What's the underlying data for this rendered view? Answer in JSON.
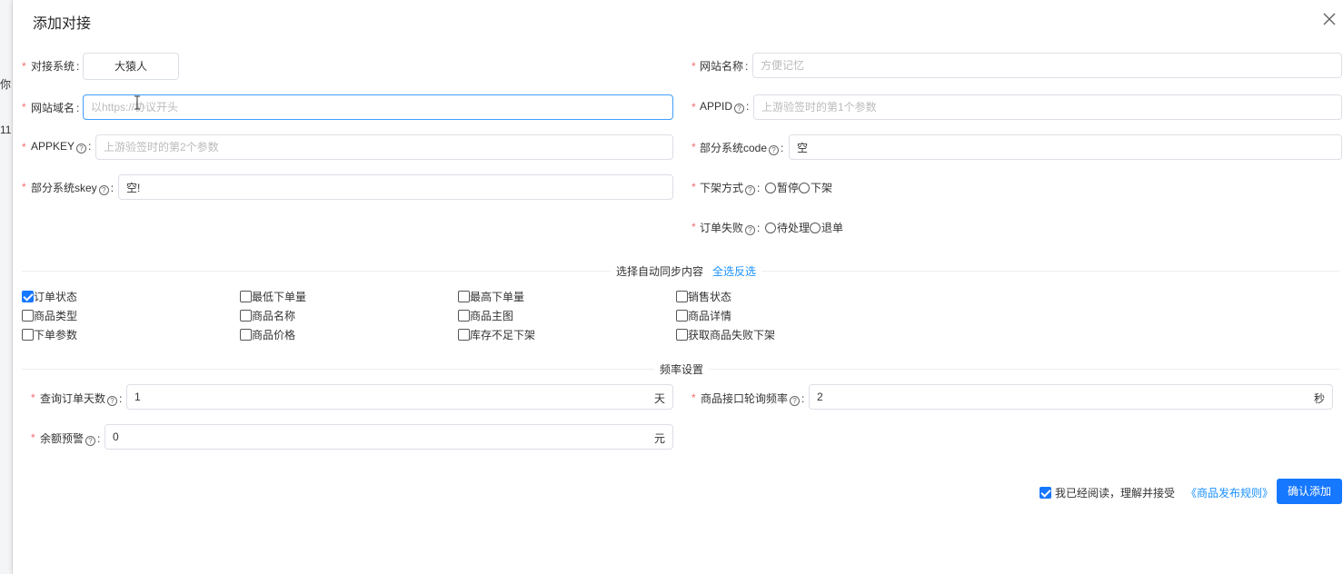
{
  "background": {
    "text1": "你",
    "text2": "11"
  },
  "dialog": {
    "title": "添加对接"
  },
  "form": {
    "system": {
      "label": "对接系统",
      "value": "大猿人"
    },
    "site_name": {
      "label": "网站名称",
      "placeholder": "方便记忆",
      "value": ""
    },
    "domain": {
      "label": "网站域名",
      "placeholder": "以https://协议开头",
      "value": ""
    },
    "appid": {
      "label": "APPID",
      "placeholder": "上游验签时的第1个参数",
      "value": ""
    },
    "appkey": {
      "label": "APPKEY",
      "placeholder": "上游验签时的第2个参数",
      "value": ""
    },
    "system_code": {
      "label": "部分系统code",
      "value": "空"
    },
    "system_skey": {
      "label": "部分系统skey",
      "value": "空!"
    },
    "offline_mode": {
      "label": "下架方式",
      "options": [
        "暂停",
        "下架"
      ]
    },
    "order_fail": {
      "label": "订单失败",
      "options": [
        "待处理",
        "退单"
      ]
    }
  },
  "sync": {
    "title": "选择自动同步内容",
    "toggle_all": "全选反选",
    "items": [
      {
        "label": "订单状态",
        "checked": true
      },
      {
        "label": "最低下单量",
        "checked": false
      },
      {
        "label": "最高下单量",
        "checked": false
      },
      {
        "label": "销售状态",
        "checked": false
      },
      {
        "label": "商品类型",
        "checked": false
      },
      {
        "label": "商品名称",
        "checked": false
      },
      {
        "label": "商品主图",
        "checked": false
      },
      {
        "label": "商品详情",
        "checked": false
      },
      {
        "label": "下单参数",
        "checked": false
      },
      {
        "label": "商品价格",
        "checked": false
      },
      {
        "label": "库存不足下架",
        "checked": false
      },
      {
        "label": "获取商品失败下架",
        "checked": false
      }
    ]
  },
  "frequency": {
    "title": "频率设置",
    "query_days": {
      "label": "查询订单天数",
      "value": "1",
      "unit": "天"
    },
    "poll_rate": {
      "label": "商品接口轮询频率",
      "value": "2",
      "unit": "秒"
    },
    "balance_alert": {
      "label": "余额预警",
      "value": "0",
      "unit": "元"
    }
  },
  "footer": {
    "agree_text": "我已经阅读，理解并接受",
    "agree_checked": true,
    "rules_link": "《商品发布规则》",
    "confirm_label": "确认添加"
  },
  "colors": {
    "primary": "#1677ff",
    "required": "#f56c6c",
    "link": "#1890ff"
  },
  "icons": {
    "help": "question-circle-icon",
    "close": "close-icon"
  }
}
